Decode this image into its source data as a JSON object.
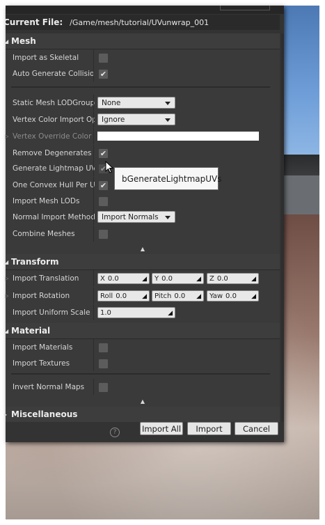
{
  "window": {
    "current_file_label": "Current File:",
    "current_file_path": "/Game/mesh/tutorial/UVunwrap_001"
  },
  "sections": {
    "mesh": {
      "title": "Mesh",
      "rows": {
        "import_as_skeletal": {
          "label": "Import as Skeletal",
          "checked": false
        },
        "auto_generate_collision": {
          "label": "Auto Generate Collision",
          "checked": true
        },
        "static_mesh_lodgroup": {
          "label": "Static Mesh LODGroup",
          "value": "None"
        },
        "vertex_color_import": {
          "label": "Vertex Color Import Option",
          "value": "Ignore"
        },
        "vertex_override_color": {
          "label": "Vertex Override Color",
          "color": "#ffffff"
        },
        "remove_degenerates": {
          "label": "Remove Degenerates",
          "checked": true
        },
        "generate_lightmap_uvs": {
          "label": "Generate Lightmap UVs",
          "checked": true
        },
        "one_convex_hull": {
          "label": "One Convex Hull Per UCX",
          "checked": true
        },
        "import_mesh_lods": {
          "label": "Import Mesh LODs",
          "checked": false
        },
        "normal_import_method": {
          "label": "Normal Import Method",
          "value": "Import Normals"
        },
        "combine_meshes": {
          "label": "Combine Meshes",
          "checked": false
        }
      }
    },
    "transform": {
      "title": "Transform",
      "import_translation": {
        "label": "Import Translation",
        "x_label": "X",
        "x": "0.0",
        "y_label": "Y",
        "y": "0.0",
        "z_label": "Z",
        "z": "0.0"
      },
      "import_rotation": {
        "label": "Import Rotation",
        "roll_label": "Roll",
        "roll": "0.0",
        "pitch_label": "Pitch",
        "pitch": "0.0",
        "yaw_label": "Yaw",
        "yaw": "0.0"
      },
      "import_uniform_scale": {
        "label": "Import Uniform Scale",
        "value": "1.0"
      }
    },
    "material": {
      "title": "Material",
      "import_materials": {
        "label": "Import Materials",
        "checked": false
      },
      "import_textures": {
        "label": "Import Textures",
        "checked": false
      },
      "invert_normal_maps": {
        "label": "Invert Normal Maps",
        "checked": false
      }
    },
    "misc": {
      "title": "Miscellaneous"
    }
  },
  "tooltip": {
    "text": "bGenerateLightmapUVs"
  },
  "buttons": {
    "help": "?",
    "import_all": "Import All",
    "import": "Import",
    "cancel": "Cancel"
  },
  "glyphs": {
    "check": "✔",
    "collapse": "▲",
    "section_open": "◢",
    "section_closed": "▸",
    "row_expand": "▷",
    "vec_arrow": "◢"
  },
  "colors": {
    "panel": "#3a3a3a",
    "dialog": "#333333",
    "sky": "#6f9ed8",
    "ground": "#9a7a6e"
  }
}
